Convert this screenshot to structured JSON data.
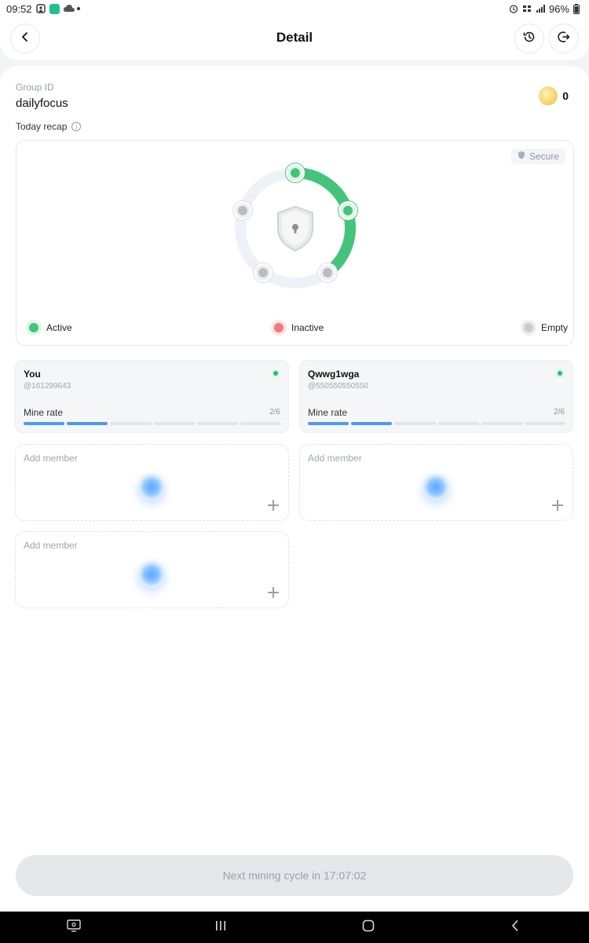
{
  "status_bar": {
    "time": "09:52",
    "battery": "96%"
  },
  "header": {
    "title": "Detail"
  },
  "group": {
    "id_label": "Group ID",
    "id_value": "dailyfocus",
    "coins": "0"
  },
  "recap": {
    "label": "Today recap",
    "secure_label": "Secure",
    "active_nodes": 2,
    "total_nodes": 5,
    "legend": {
      "active": "Active",
      "inactive": "Inactive",
      "empty": "Empty"
    }
  },
  "members": [
    {
      "name": "You",
      "handle": "@161299643",
      "rate_label": "Mine rate",
      "rate_value": "2/6",
      "segments_on": 2,
      "segments_total": 6,
      "online": true
    },
    {
      "name": "Qwwg1wga",
      "handle": "@550550550550",
      "rate_label": "Mine rate",
      "rate_value": "2/6",
      "segments_on": 2,
      "segments_total": 6,
      "online": true
    }
  ],
  "add_member": {
    "label": "Add member"
  },
  "cta": {
    "label": "Next mining cycle in 17:07:02"
  },
  "colors": {
    "active": "#22c06b",
    "inactive": "#f07a7a",
    "empty": "#c9ccd1",
    "progress": "#4b9cf2"
  }
}
